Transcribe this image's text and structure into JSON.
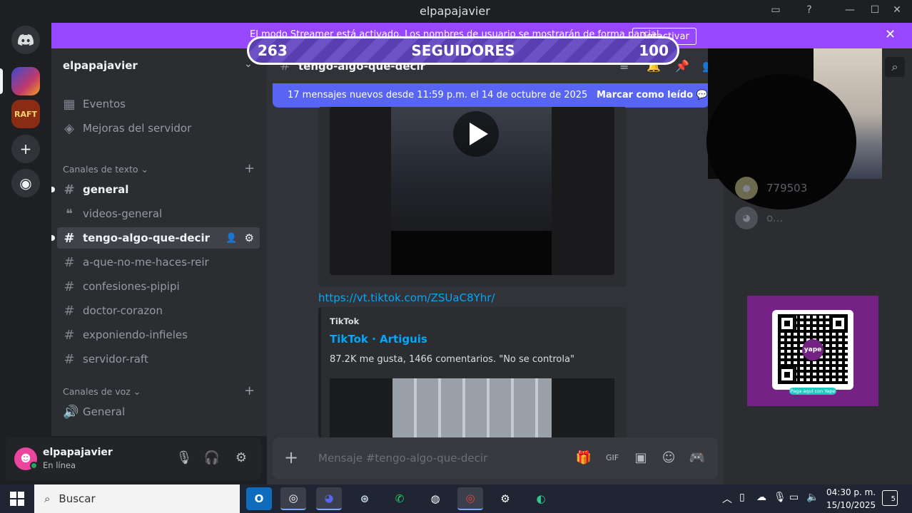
{
  "window": {
    "title": "elpapajavier"
  },
  "streamer": {
    "message": "El modo Streamer está activado. Los nombres de usuario se mostrarán de forma parcial.",
    "button": "Desactivar",
    "close": "✕"
  },
  "followers_widget": {
    "current": "263",
    "label": "SEGUIDORES",
    "goal": "100"
  },
  "server": {
    "name": "elpapajavier"
  },
  "sidebar": {
    "top_items": [
      {
        "label": "Eventos",
        "icon": "calendar-icon"
      },
      {
        "label": "Mejoras del servidor",
        "icon": "boost-icon"
      }
    ],
    "text_category": "Canales de texto",
    "text_channels": [
      {
        "label": "general",
        "icon": "#"
      },
      {
        "label": "videos-general",
        "icon": "forum"
      },
      {
        "label": "tengo-algo-que-decir",
        "icon": "#"
      },
      {
        "label": "a-que-no-me-haces-reir",
        "icon": "#"
      },
      {
        "label": "confesiones-pipipi",
        "icon": "#"
      },
      {
        "label": "doctor-corazon",
        "icon": "#"
      },
      {
        "label": "exponiendo-infieles",
        "icon": "#"
      },
      {
        "label": "servidor-raft",
        "icon": "#"
      }
    ],
    "voice_category": "Canales de voz",
    "voice_channels": [
      {
        "label": "General",
        "icon": "speaker-icon"
      }
    ]
  },
  "user": {
    "name": "elpapajavier",
    "status": "En línea"
  },
  "channel": {
    "name": "tengo-algo-que-decir"
  },
  "new_messages": {
    "text": "17 mensajes nuevos desde 11:59 p.m. el 14 de octubre de 2025",
    "mark_read": "Marcar como leído"
  },
  "messages": {
    "link": "https://vt.tiktok.com/ZSUaC8Yhr/",
    "embed": {
      "provider": "TikTok",
      "title": "TikTok · Artiguis",
      "description": "87.2K me gusta, 1466 comentarios. \"No se controla\""
    }
  },
  "composer": {
    "placeholder": "Mensaje #tengo-algo-que-decir"
  },
  "members": [
    {
      "name": "779503"
    },
    {
      "name": "o..."
    }
  ],
  "qr": {
    "logo": "yape",
    "tag": "Paga aquí con Yape"
  },
  "taskbar": {
    "search_placeholder": "Buscar",
    "time": "04:30 p. m.",
    "date": "15/10/2025",
    "notifications": "5"
  },
  "colors": {
    "streamer": "#9747ff",
    "blurple": "#5865f2",
    "link": "#00a8fc",
    "online": "#23a55a"
  }
}
